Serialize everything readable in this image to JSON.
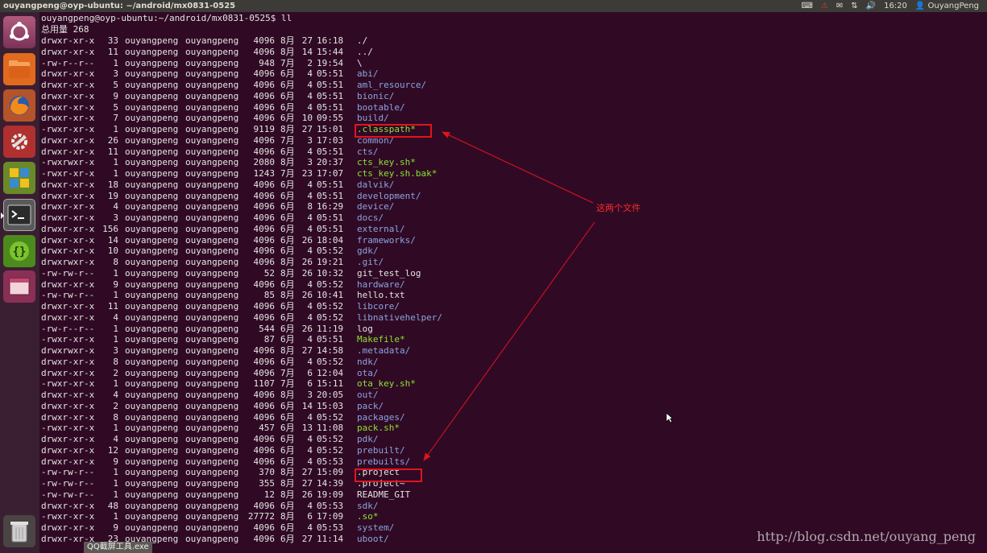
{
  "window_title": "ouyangpeng@oyp-ubuntu: ~/android/mx0831-0525",
  "tray": {
    "time": "16:20",
    "user": "OuyangPeng",
    "icons": [
      "keyboard-icon",
      "alert-icon",
      "mail-icon",
      "network-icon",
      "volume-icon",
      "user-icon"
    ]
  },
  "launcher": [
    "dash-icon",
    "files-icon",
    "firefox-icon",
    "settings-icon",
    "workspace-icon",
    "terminal-icon",
    "brackets-icon",
    "window-manager-icon",
    "trash-icon"
  ],
  "terminal": {
    "prompt": "ouyangpeng@oyp-ubuntu:~/android/mx0831-0525$ ll",
    "total": "总用量 268",
    "rows": [
      {
        "perm": "drwxr-xr-x",
        "links": "33",
        "owner": "ouyangpeng",
        "group": "ouyangpeng",
        "size": "4096",
        "month": "8月",
        "day": "27",
        "time": "16:18",
        "name": "./",
        "kind": "txt"
      },
      {
        "perm": "drwxr-xr-x",
        "links": "11",
        "owner": "ouyangpeng",
        "group": "ouyangpeng",
        "size": "4096",
        "month": "8月",
        "day": "14",
        "time": "15:44",
        "name": "../",
        "kind": "txt"
      },
      {
        "perm": "-rw-r--r--",
        "links": "1",
        "owner": "ouyangpeng",
        "group": "ouyangpeng",
        "size": "948",
        "month": "7月",
        "day": "2",
        "time": "19:54",
        "name": "\\",
        "kind": "txt"
      },
      {
        "perm": "drwxr-xr-x",
        "links": "3",
        "owner": "ouyangpeng",
        "group": "ouyangpeng",
        "size": "4096",
        "month": "6月",
        "day": "4",
        "time": "05:51",
        "name": "abi/",
        "kind": "dir"
      },
      {
        "perm": "drwxr-xr-x",
        "links": "5",
        "owner": "ouyangpeng",
        "group": "ouyangpeng",
        "size": "4096",
        "month": "6月",
        "day": "4",
        "time": "05:51",
        "name": "aml_resource/",
        "kind": "dir"
      },
      {
        "perm": "drwxr-xr-x",
        "links": "9",
        "owner": "ouyangpeng",
        "group": "ouyangpeng",
        "size": "4096",
        "month": "6月",
        "day": "4",
        "time": "05:51",
        "name": "bionic/",
        "kind": "dir"
      },
      {
        "perm": "drwxr-xr-x",
        "links": "5",
        "owner": "ouyangpeng",
        "group": "ouyangpeng",
        "size": "4096",
        "month": "6月",
        "day": "4",
        "time": "05:51",
        "name": "bootable/",
        "kind": "dir"
      },
      {
        "perm": "drwxr-xr-x",
        "links": "7",
        "owner": "ouyangpeng",
        "group": "ouyangpeng",
        "size": "4096",
        "month": "6月",
        "day": "10",
        "time": "09:55",
        "name": "build/",
        "kind": "dir"
      },
      {
        "perm": "-rwxr-xr-x",
        "links": "1",
        "owner": "ouyangpeng",
        "group": "ouyangpeng",
        "size": "9119",
        "month": "8月",
        "day": "27",
        "time": "15:01",
        "name": ".classpath*",
        "kind": "exe"
      },
      {
        "perm": "drwxr-xr-x",
        "links": "26",
        "owner": "ouyangpeng",
        "group": "ouyangpeng",
        "size": "4096",
        "month": "7月",
        "day": "3",
        "time": "17:03",
        "name": "common/",
        "kind": "dir"
      },
      {
        "perm": "drwxr-xr-x",
        "links": "11",
        "owner": "ouyangpeng",
        "group": "ouyangpeng",
        "size": "4096",
        "month": "6月",
        "day": "4",
        "time": "05:51",
        "name": "cts/",
        "kind": "dir"
      },
      {
        "perm": "-rwxrwxr-x",
        "links": "1",
        "owner": "ouyangpeng",
        "group": "ouyangpeng",
        "size": "2080",
        "month": "8月",
        "day": "3",
        "time": "20:37",
        "name": "cts_key.sh*",
        "kind": "exe"
      },
      {
        "perm": "-rwxr-xr-x",
        "links": "1",
        "owner": "ouyangpeng",
        "group": "ouyangpeng",
        "size": "1243",
        "month": "7月",
        "day": "23",
        "time": "17:07",
        "name": "cts_key.sh.bak*",
        "kind": "exe"
      },
      {
        "perm": "drwxr-xr-x",
        "links": "18",
        "owner": "ouyangpeng",
        "group": "ouyangpeng",
        "size": "4096",
        "month": "6月",
        "day": "4",
        "time": "05:51",
        "name": "dalvik/",
        "kind": "dir"
      },
      {
        "perm": "drwxr-xr-x",
        "links": "19",
        "owner": "ouyangpeng",
        "group": "ouyangpeng",
        "size": "4096",
        "month": "6月",
        "day": "4",
        "time": "05:51",
        "name": "development/",
        "kind": "dir"
      },
      {
        "perm": "drwxr-xr-x",
        "links": "4",
        "owner": "ouyangpeng",
        "group": "ouyangpeng",
        "size": "4096",
        "month": "6月",
        "day": "8",
        "time": "16:29",
        "name": "device/",
        "kind": "dir"
      },
      {
        "perm": "drwxr-xr-x",
        "links": "3",
        "owner": "ouyangpeng",
        "group": "ouyangpeng",
        "size": "4096",
        "month": "6月",
        "day": "4",
        "time": "05:51",
        "name": "docs/",
        "kind": "dir"
      },
      {
        "perm": "drwxr-xr-x",
        "links": "156",
        "owner": "ouyangpeng",
        "group": "ouyangpeng",
        "size": "4096",
        "month": "6月",
        "day": "4",
        "time": "05:51",
        "name": "external/",
        "kind": "dir"
      },
      {
        "perm": "drwxr-xr-x",
        "links": "14",
        "owner": "ouyangpeng",
        "group": "ouyangpeng",
        "size": "4096",
        "month": "6月",
        "day": "26",
        "time": "18:04",
        "name": "frameworks/",
        "kind": "dir"
      },
      {
        "perm": "drwxr-xr-x",
        "links": "10",
        "owner": "ouyangpeng",
        "group": "ouyangpeng",
        "size": "4096",
        "month": "6月",
        "day": "4",
        "time": "05:52",
        "name": "gdk/",
        "kind": "dir"
      },
      {
        "perm": "drwxrwxr-x",
        "links": "8",
        "owner": "ouyangpeng",
        "group": "ouyangpeng",
        "size": "4096",
        "month": "8月",
        "day": "26",
        "time": "19:21",
        "name": ".git/",
        "kind": "dir"
      },
      {
        "perm": "-rw-rw-r--",
        "links": "1",
        "owner": "ouyangpeng",
        "group": "ouyangpeng",
        "size": "52",
        "month": "8月",
        "day": "26",
        "time": "10:32",
        "name": "git_test_log",
        "kind": "txt"
      },
      {
        "perm": "drwxr-xr-x",
        "links": "9",
        "owner": "ouyangpeng",
        "group": "ouyangpeng",
        "size": "4096",
        "month": "6月",
        "day": "4",
        "time": "05:52",
        "name": "hardware/",
        "kind": "dir"
      },
      {
        "perm": "-rw-rw-r--",
        "links": "1",
        "owner": "ouyangpeng",
        "group": "ouyangpeng",
        "size": "85",
        "month": "8月",
        "day": "26",
        "time": "10:41",
        "name": "hello.txt",
        "kind": "txt"
      },
      {
        "perm": "drwxr-xr-x",
        "links": "11",
        "owner": "ouyangpeng",
        "group": "ouyangpeng",
        "size": "4096",
        "month": "6月",
        "day": "4",
        "time": "05:52",
        "name": "libcore/",
        "kind": "dir"
      },
      {
        "perm": "drwxr-xr-x",
        "links": "4",
        "owner": "ouyangpeng",
        "group": "ouyangpeng",
        "size": "4096",
        "month": "6月",
        "day": "4",
        "time": "05:52",
        "name": "libnativehelper/",
        "kind": "dir"
      },
      {
        "perm": "-rw-r--r--",
        "links": "1",
        "owner": "ouyangpeng",
        "group": "ouyangpeng",
        "size": "544",
        "month": "6月",
        "day": "26",
        "time": "11:19",
        "name": "log",
        "kind": "txt"
      },
      {
        "perm": "-rwxr-xr-x",
        "links": "1",
        "owner": "ouyangpeng",
        "group": "ouyangpeng",
        "size": "87",
        "month": "6月",
        "day": "4",
        "time": "05:51",
        "name": "Makefile*",
        "kind": "exe"
      },
      {
        "perm": "drwxrwxr-x",
        "links": "3",
        "owner": "ouyangpeng",
        "group": "ouyangpeng",
        "size": "4096",
        "month": "8月",
        "day": "27",
        "time": "14:58",
        "name": ".metadata/",
        "kind": "dir"
      },
      {
        "perm": "drwxr-xr-x",
        "links": "8",
        "owner": "ouyangpeng",
        "group": "ouyangpeng",
        "size": "4096",
        "month": "6月",
        "day": "4",
        "time": "05:52",
        "name": "ndk/",
        "kind": "dir"
      },
      {
        "perm": "drwxr-xr-x",
        "links": "2",
        "owner": "ouyangpeng",
        "group": "ouyangpeng",
        "size": "4096",
        "month": "7月",
        "day": "6",
        "time": "12:04",
        "name": "ota/",
        "kind": "dir"
      },
      {
        "perm": "-rwxr-xr-x",
        "links": "1",
        "owner": "ouyangpeng",
        "group": "ouyangpeng",
        "size": "1107",
        "month": "7月",
        "day": "6",
        "time": "15:11",
        "name": "ota_key.sh*",
        "kind": "exe"
      },
      {
        "perm": "drwxr-xr-x",
        "links": "4",
        "owner": "ouyangpeng",
        "group": "ouyangpeng",
        "size": "4096",
        "month": "8月",
        "day": "3",
        "time": "20:05",
        "name": "out/",
        "kind": "dir"
      },
      {
        "perm": "drwxr-xr-x",
        "links": "2",
        "owner": "ouyangpeng",
        "group": "ouyangpeng",
        "size": "4096",
        "month": "6月",
        "day": "14",
        "time": "15:03",
        "name": "pack/",
        "kind": "dir"
      },
      {
        "perm": "drwxr-xr-x",
        "links": "8",
        "owner": "ouyangpeng",
        "group": "ouyangpeng",
        "size": "4096",
        "month": "6月",
        "day": "4",
        "time": "05:52",
        "name": "packages/",
        "kind": "dir"
      },
      {
        "perm": "-rwxr-xr-x",
        "links": "1",
        "owner": "ouyangpeng",
        "group": "ouyangpeng",
        "size": "457",
        "month": "6月",
        "day": "13",
        "time": "11:08",
        "name": "pack.sh*",
        "kind": "exe"
      },
      {
        "perm": "drwxr-xr-x",
        "links": "4",
        "owner": "ouyangpeng",
        "group": "ouyangpeng",
        "size": "4096",
        "month": "6月",
        "day": "4",
        "time": "05:52",
        "name": "pdk/",
        "kind": "dir"
      },
      {
        "perm": "drwxr-xr-x",
        "links": "12",
        "owner": "ouyangpeng",
        "group": "ouyangpeng",
        "size": "4096",
        "month": "6月",
        "day": "4",
        "time": "05:52",
        "name": "prebuilt/",
        "kind": "dir"
      },
      {
        "perm": "drwxr-xr-x",
        "links": "9",
        "owner": "ouyangpeng",
        "group": "ouyangpeng",
        "size": "4096",
        "month": "6月",
        "day": "4",
        "time": "05:53",
        "name": "prebuilts/",
        "kind": "dir"
      },
      {
        "perm": "-rw-rw-r--",
        "links": "1",
        "owner": "ouyangpeng",
        "group": "ouyangpeng",
        "size": "370",
        "month": "8月",
        "day": "27",
        "time": "15:09",
        "name": ".project",
        "kind": "txt"
      },
      {
        "perm": "-rw-rw-r--",
        "links": "1",
        "owner": "ouyangpeng",
        "group": "ouyangpeng",
        "size": "355",
        "month": "8月",
        "day": "27",
        "time": "14:39",
        "name": ".project~",
        "kind": "txt"
      },
      {
        "perm": "-rw-rw-r--",
        "links": "1",
        "owner": "ouyangpeng",
        "group": "ouyangpeng",
        "size": "12",
        "month": "8月",
        "day": "26",
        "time": "19:09",
        "name": "README_GIT",
        "kind": "txt"
      },
      {
        "perm": "drwxr-xr-x",
        "links": "48",
        "owner": "ouyangpeng",
        "group": "ouyangpeng",
        "size": "4096",
        "month": "6月",
        "day": "4",
        "time": "05:53",
        "name": "sdk/",
        "kind": "dir"
      },
      {
        "perm": "-rwxr-xr-x",
        "links": "1",
        "owner": "ouyangpeng",
        "group": "ouyangpeng",
        "size": "27772",
        "month": "8月",
        "day": "6",
        "time": "17:09",
        "name": ".so*",
        "kind": "exe"
      },
      {
        "perm": "drwxr-xr-x",
        "links": "9",
        "owner": "ouyangpeng",
        "group": "ouyangpeng",
        "size": "4096",
        "month": "6月",
        "day": "4",
        "time": "05:53",
        "name": "system/",
        "kind": "dir"
      },
      {
        "perm": "drwxr-xr-x",
        "links": "23",
        "owner": "ouyangpeng",
        "group": "ouyangpeng",
        "size": "4096",
        "month": "6月",
        "day": "27",
        "time": "11:14",
        "name": "uboot/",
        "kind": "dir"
      }
    ]
  },
  "annotation": "这两个文件",
  "watermark": "http://blog.csdn.net/ouyang_peng",
  "taskbar_tip": "QQ截屏工具.exe",
  "colors": {
    "background": "#300a24",
    "directory": "#8aa4e0",
    "executable": "#8ae234",
    "highlight_box": "#e0141e"
  }
}
